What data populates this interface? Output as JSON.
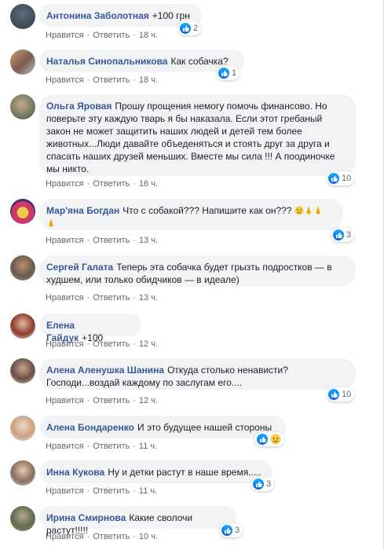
{
  "labels": {
    "like": "Нравится",
    "reply": "Ответить",
    "sep": "·"
  },
  "comments": [
    {
      "author": "Антонина Заболотная",
      "text": "+100 грн",
      "time": "18 ч.",
      "reactions": "2"
    },
    {
      "author": "Наталья Синопальникова",
      "text": "Как собачка?",
      "time": "18 ч.",
      "reactions": "1"
    },
    {
      "author": "Ольга Яровая",
      "text": "Прошу прощения немогу помочь финансово. Но поверьте эту каждую тварь я бы наказала. Если этот гребаный закон не может защитить наших людей и детей тем более животных...Люди давайте объеденяться и стоять друг за друга и спасать наших друзей меньших. Вместе мы сила !!! А поодиночке мы никто.",
      "time": "16 ч.",
      "reactions": "10"
    },
    {
      "author": "Мар'яна Богдан",
      "text": "Что с собакой??? Напишите как он???",
      "time": "13 ч.",
      "reactions": "3"
    },
    {
      "author": "Сергей Галата",
      "text": "Теперь эта собачка будет грызть подростков — в худшем, или только обидчиков — в идеале)",
      "time": "13 ч.",
      "reactions": ""
    },
    {
      "author": "Елена Гайдук",
      "text": "+100",
      "time": "12 ч.",
      "reactions": ""
    },
    {
      "author": "Алена Аленушка Шанина",
      "text": "Откуда столько ненависти? Господи...воздай каждому по заслугам его....",
      "time": "12 ч.",
      "reactions": "10"
    },
    {
      "author": "Алена Бондаренко",
      "text": "И это будущее нашей стороны",
      "time": "11 ч.",
      "reactions": ""
    },
    {
      "author": "Инна Кукова",
      "text": "Ну и детки растут в наше время.....",
      "time": "11 ч.",
      "reactions": "3"
    },
    {
      "author": "Ирина Смирнова",
      "text": "Какие сволочи растут!!!!!",
      "time": "10 ч.",
      "reactions": "3"
    }
  ],
  "colors": {
    "author": "#385898",
    "bubble": "#f2f3f5",
    "meta": "#606770",
    "like": "#1877f2"
  }
}
